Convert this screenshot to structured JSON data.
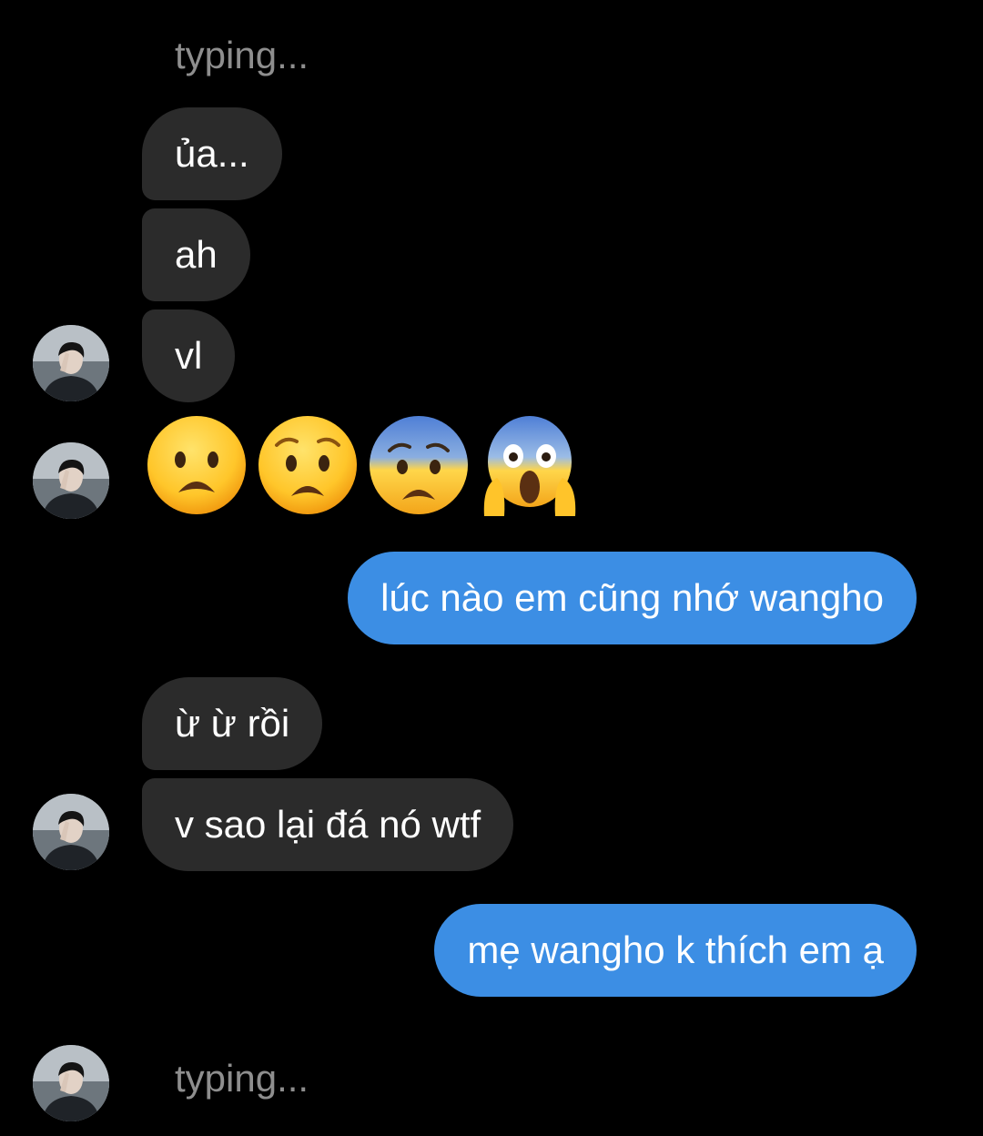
{
  "typing_top": "typing...",
  "typing_bottom": "typing...",
  "messages": {
    "m1": "ủa...",
    "m2": "ah",
    "m3": "vl",
    "m4": "lúc nào em cũng nhớ wangho",
    "m5": "ừ ừ rồi",
    "m6": "v sao lại đá nó wtf",
    "m7": "mẹ wangho k thích em ạ"
  },
  "emojis": [
    "frowning-face-open-mouth",
    "anguished-face",
    "fearful-face",
    "face-screaming-in-fear"
  ],
  "colors": {
    "background": "#000000",
    "incoming_bubble": "#2b2b2b",
    "outgoing_bubble": "#3c8ee4",
    "typing_text": "#8e8e8e"
  }
}
